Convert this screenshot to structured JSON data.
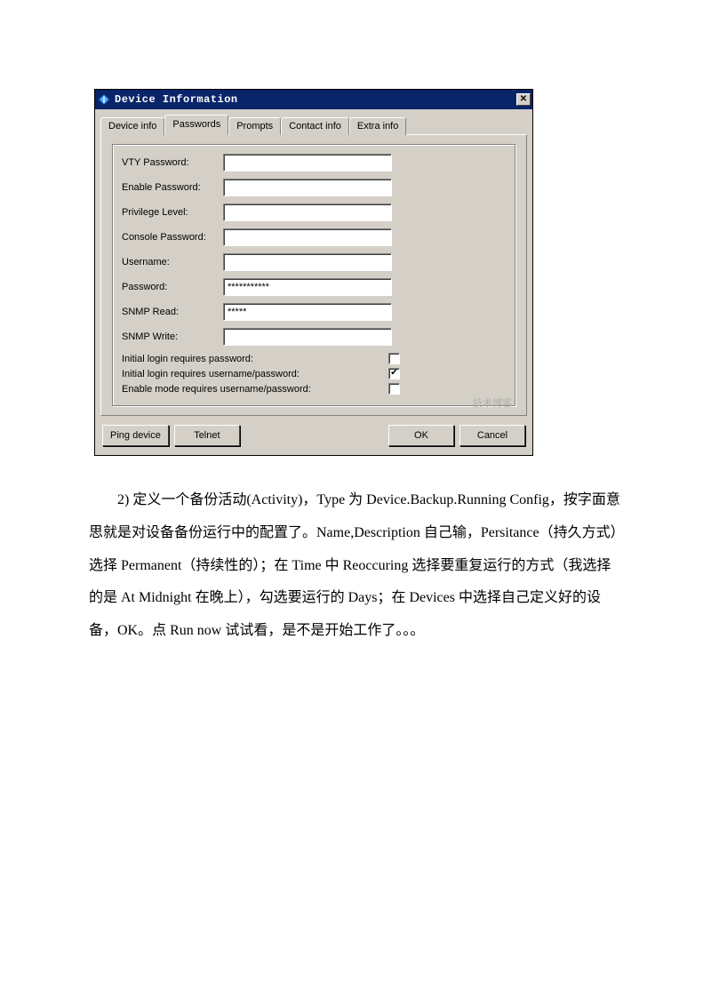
{
  "dialog": {
    "title": "Device Information",
    "tabs": [
      "Device info",
      "Passwords",
      "Prompts",
      "Contact info",
      "Extra info"
    ],
    "activeTab": 1,
    "fields": [
      {
        "label": "VTY Password:",
        "value": ""
      },
      {
        "label": "Enable Password:",
        "value": ""
      },
      {
        "label": "Privilege Level:",
        "value": ""
      },
      {
        "label": "Console Password:",
        "value": ""
      },
      {
        "label": "Username:",
        "value": ""
      },
      {
        "label": "Password:",
        "value": "***********"
      },
      {
        "label": "SNMP Read:",
        "value": "*****"
      },
      {
        "label": "SNMP Write:",
        "value": ""
      }
    ],
    "checks": [
      {
        "label": "Initial login requires password:",
        "checked": false
      },
      {
        "label": "Initial login requires username/password:",
        "checked": true
      },
      {
        "label": "Enable mode requires username/password:",
        "checked": false
      }
    ],
    "buttons": {
      "ping": "Ping device",
      "telnet": "Telnet",
      "ok": "OK",
      "cancel": "Cancel"
    },
    "watermark": "技术博客"
  },
  "article": {
    "paragraph": "2)  定义一个备份活动(Activity)，Type 为 Device.Backup.Running Config，按字面意思就是对设备备份运行中的配置了。Name,Description 自己输，Persitance（持久方式）选择 Permanent（持续性的）；在 Time 中 Reoccuring 选择要重复运行的方式（我选择的是 At Midnight 在晚上），勾选要运行的 Days；在 Devices 中选择自己定义好的设备，OK。点 Run  now 试试看，是不是开始工作了。。。"
  },
  "close_glyph": "✕",
  "check_glyph": "✔"
}
